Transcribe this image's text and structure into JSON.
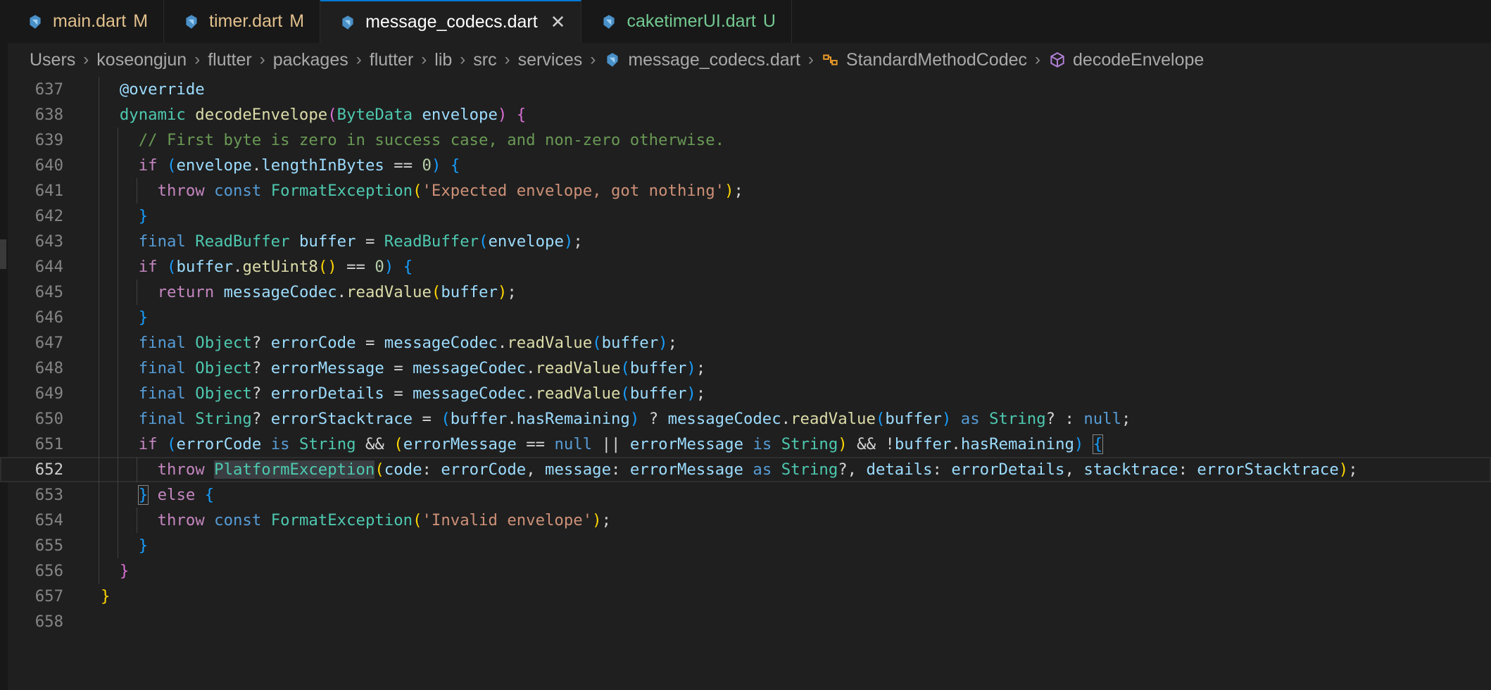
{
  "tabs": [
    {
      "name": "main.dart",
      "badge": "M",
      "state": "modified"
    },
    {
      "name": "timer.dart",
      "badge": "M",
      "state": "modified"
    },
    {
      "name": "message_codecs.dart",
      "badge": "",
      "state": "active",
      "close": "✕"
    },
    {
      "name": "caketimerUI.dart",
      "badge": "U",
      "state": "untracked"
    }
  ],
  "breadcrumb": [
    "Users",
    "koseongjun",
    "flutter",
    "packages",
    "flutter",
    "lib",
    "src",
    "services",
    "message_codecs.dart",
    "StandardMethodCodec",
    "decodeEnvelope"
  ],
  "breadcrumb_sep": "›",
  "editor": {
    "current_line": 652,
    "lines": [
      {
        "n": 637,
        "i": 1,
        "t": [
          [
            "@override",
            "v"
          ]
        ]
      },
      {
        "n": 638,
        "i": 1,
        "t": [
          [
            "dynamic",
            "t"
          ],
          [
            " ",
            "p"
          ],
          [
            "decodeEnvelope",
            "f"
          ],
          [
            "(",
            "b2"
          ],
          [
            "ByteData",
            "t"
          ],
          [
            " ",
            "p"
          ],
          [
            "envelope",
            "v"
          ],
          [
            ")",
            "b2"
          ],
          [
            " ",
            "p"
          ],
          [
            "{",
            "b2"
          ]
        ]
      },
      {
        "n": 639,
        "i": 2,
        "t": [
          [
            "// First byte is zero in success case, and non-zero otherwise.",
            "cm"
          ]
        ]
      },
      {
        "n": 640,
        "i": 2,
        "t": [
          [
            "if",
            "c"
          ],
          [
            " ",
            "p"
          ],
          [
            "(",
            "b3"
          ],
          [
            "envelope",
            "v"
          ],
          [
            ".",
            "p"
          ],
          [
            "lengthInBytes",
            "v"
          ],
          [
            " == ",
            "p"
          ],
          [
            "0",
            "n"
          ],
          [
            ")",
            "b3"
          ],
          [
            " ",
            "p"
          ],
          [
            "{",
            "b3"
          ]
        ]
      },
      {
        "n": 641,
        "i": 3,
        "t": [
          [
            "throw",
            "c"
          ],
          [
            " ",
            "p"
          ],
          [
            "const",
            "k"
          ],
          [
            " ",
            "p"
          ],
          [
            "FormatException",
            "t"
          ],
          [
            "(",
            "b1"
          ],
          [
            "'Expected envelope, got nothing'",
            "s"
          ],
          [
            ")",
            "b1"
          ],
          [
            ";",
            "p"
          ]
        ]
      },
      {
        "n": 642,
        "i": 2,
        "t": [
          [
            "}",
            "b3"
          ]
        ]
      },
      {
        "n": 643,
        "i": 2,
        "t": [
          [
            "final",
            "k"
          ],
          [
            " ",
            "p"
          ],
          [
            "ReadBuffer",
            "t"
          ],
          [
            " ",
            "p"
          ],
          [
            "buffer",
            "v"
          ],
          [
            " = ",
            "p"
          ],
          [
            "ReadBuffer",
            "t"
          ],
          [
            "(",
            "b3"
          ],
          [
            "envelope",
            "v"
          ],
          [
            ")",
            "b3"
          ],
          [
            ";",
            "p"
          ]
        ]
      },
      {
        "n": 644,
        "i": 2,
        "t": [
          [
            "if",
            "c"
          ],
          [
            " ",
            "p"
          ],
          [
            "(",
            "b3"
          ],
          [
            "buffer",
            "v"
          ],
          [
            ".",
            "p"
          ],
          [
            "getUint8",
            "f"
          ],
          [
            "()",
            "b1"
          ],
          [
            " == ",
            "p"
          ],
          [
            "0",
            "n"
          ],
          [
            ")",
            "b3"
          ],
          [
            " ",
            "p"
          ],
          [
            "{",
            "b3"
          ]
        ]
      },
      {
        "n": 645,
        "i": 3,
        "t": [
          [
            "return",
            "c"
          ],
          [
            " ",
            "p"
          ],
          [
            "messageCodec",
            "v"
          ],
          [
            ".",
            "p"
          ],
          [
            "readValue",
            "f"
          ],
          [
            "(",
            "b1"
          ],
          [
            "buffer",
            "v"
          ],
          [
            ")",
            "b1"
          ],
          [
            ";",
            "p"
          ]
        ]
      },
      {
        "n": 646,
        "i": 2,
        "t": [
          [
            "}",
            "b3"
          ]
        ]
      },
      {
        "n": 647,
        "i": 2,
        "t": [
          [
            "final",
            "k"
          ],
          [
            " ",
            "p"
          ],
          [
            "Object",
            "t"
          ],
          [
            "? ",
            "p"
          ],
          [
            "errorCode",
            "v"
          ],
          [
            " = ",
            "p"
          ],
          [
            "messageCodec",
            "v"
          ],
          [
            ".",
            "p"
          ],
          [
            "readValue",
            "f"
          ],
          [
            "(",
            "b3"
          ],
          [
            "buffer",
            "v"
          ],
          [
            ")",
            "b3"
          ],
          [
            ";",
            "p"
          ]
        ]
      },
      {
        "n": 648,
        "i": 2,
        "t": [
          [
            "final",
            "k"
          ],
          [
            " ",
            "p"
          ],
          [
            "Object",
            "t"
          ],
          [
            "? ",
            "p"
          ],
          [
            "errorMessage",
            "v"
          ],
          [
            " = ",
            "p"
          ],
          [
            "messageCodec",
            "v"
          ],
          [
            ".",
            "p"
          ],
          [
            "readValue",
            "f"
          ],
          [
            "(",
            "b3"
          ],
          [
            "buffer",
            "v"
          ],
          [
            ")",
            "b3"
          ],
          [
            ";",
            "p"
          ]
        ]
      },
      {
        "n": 649,
        "i": 2,
        "t": [
          [
            "final",
            "k"
          ],
          [
            " ",
            "p"
          ],
          [
            "Object",
            "t"
          ],
          [
            "? ",
            "p"
          ],
          [
            "errorDetails",
            "v"
          ],
          [
            " = ",
            "p"
          ],
          [
            "messageCodec",
            "v"
          ],
          [
            ".",
            "p"
          ],
          [
            "readValue",
            "f"
          ],
          [
            "(",
            "b3"
          ],
          [
            "buffer",
            "v"
          ],
          [
            ")",
            "b3"
          ],
          [
            ";",
            "p"
          ]
        ]
      },
      {
        "n": 650,
        "i": 2,
        "t": [
          [
            "final",
            "k"
          ],
          [
            " ",
            "p"
          ],
          [
            "String",
            "t"
          ],
          [
            "? ",
            "p"
          ],
          [
            "errorStacktrace",
            "v"
          ],
          [
            " = ",
            "p"
          ],
          [
            "(",
            "b3"
          ],
          [
            "buffer",
            "v"
          ],
          [
            ".",
            "p"
          ],
          [
            "hasRemaining",
            "v"
          ],
          [
            ")",
            "b3"
          ],
          [
            " ? ",
            "p"
          ],
          [
            "messageCodec",
            "v"
          ],
          [
            ".",
            "p"
          ],
          [
            "readValue",
            "f"
          ],
          [
            "(",
            "b3"
          ],
          [
            "buffer",
            "v"
          ],
          [
            ")",
            "b3"
          ],
          [
            " ",
            "p"
          ],
          [
            "as",
            "k"
          ],
          [
            " ",
            "p"
          ],
          [
            "String",
            "t"
          ],
          [
            "? : ",
            "p"
          ],
          [
            "null",
            "k"
          ],
          [
            ";",
            "p"
          ]
        ]
      },
      {
        "n": 651,
        "i": 2,
        "t": [
          [
            "if",
            "c"
          ],
          [
            " ",
            "p"
          ],
          [
            "(",
            "b3"
          ],
          [
            "errorCode",
            "v"
          ],
          [
            " ",
            "p"
          ],
          [
            "is",
            "k"
          ],
          [
            " ",
            "p"
          ],
          [
            "String",
            "t"
          ],
          [
            " && ",
            "p"
          ],
          [
            "(",
            "b1"
          ],
          [
            "errorMessage",
            "v"
          ],
          [
            " == ",
            "p"
          ],
          [
            "null",
            "k"
          ],
          [
            " || ",
            "p"
          ],
          [
            "errorMessage",
            "v"
          ],
          [
            " ",
            "p"
          ],
          [
            "is",
            "k"
          ],
          [
            " ",
            "p"
          ],
          [
            "String",
            "t"
          ],
          [
            ")",
            "b1"
          ],
          [
            " && !",
            "p"
          ],
          [
            "buffer",
            "v"
          ],
          [
            ".",
            "p"
          ],
          [
            "hasRemaining",
            "v"
          ],
          [
            ")",
            "b3"
          ],
          [
            " ",
            "p"
          ],
          [
            "{",
            "b3 bm"
          ]
        ]
      },
      {
        "n": 652,
        "i": 3,
        "t": [
          [
            "throw",
            "c"
          ],
          [
            " ",
            "p"
          ],
          [
            "PlatformException",
            "t hl"
          ],
          [
            "(",
            "b1"
          ],
          [
            "code",
            "v"
          ],
          [
            ": ",
            "p"
          ],
          [
            "errorCode",
            "v"
          ],
          [
            ", ",
            "p"
          ],
          [
            "message",
            "v"
          ],
          [
            ": ",
            "p"
          ],
          [
            "errorMessage",
            "v"
          ],
          [
            " ",
            "p"
          ],
          [
            "as",
            "k"
          ],
          [
            " ",
            "p"
          ],
          [
            "String",
            "t"
          ],
          [
            "?, ",
            "p"
          ],
          [
            "details",
            "v"
          ],
          [
            ": ",
            "p"
          ],
          [
            "errorDetails",
            "v"
          ],
          [
            ", ",
            "p"
          ],
          [
            "stacktrace",
            "v"
          ],
          [
            ": ",
            "p"
          ],
          [
            "errorStacktrace",
            "v"
          ],
          [
            ")",
            "b1"
          ],
          [
            ";",
            "p"
          ]
        ]
      },
      {
        "n": 653,
        "i": 2,
        "t": [
          [
            "}",
            "b3 bm"
          ],
          [
            " ",
            "p"
          ],
          [
            "else",
            "c"
          ],
          [
            " ",
            "p"
          ],
          [
            "{",
            "b3"
          ]
        ]
      },
      {
        "n": 654,
        "i": 3,
        "t": [
          [
            "throw",
            "c"
          ],
          [
            " ",
            "p"
          ],
          [
            "const",
            "k"
          ],
          [
            " ",
            "p"
          ],
          [
            "FormatException",
            "t"
          ],
          [
            "(",
            "b1"
          ],
          [
            "'Invalid envelope'",
            "s"
          ],
          [
            ")",
            "b1"
          ],
          [
            ";",
            "p"
          ]
        ]
      },
      {
        "n": 655,
        "i": 2,
        "t": [
          [
            "}",
            "b3"
          ]
        ]
      },
      {
        "n": 656,
        "i": 1,
        "t": [
          [
            "}",
            "b2"
          ]
        ]
      },
      {
        "n": 657,
        "i": 0,
        "t": [
          [
            "}",
            "b1"
          ]
        ]
      },
      {
        "n": 658,
        "i": 0,
        "t": []
      }
    ]
  },
  "colors": {
    "background": "#1f1f1f",
    "tab_inactive": "#181818",
    "modified": "#e2c08d",
    "untracked": "#73c991",
    "accent": "#0078d4"
  }
}
